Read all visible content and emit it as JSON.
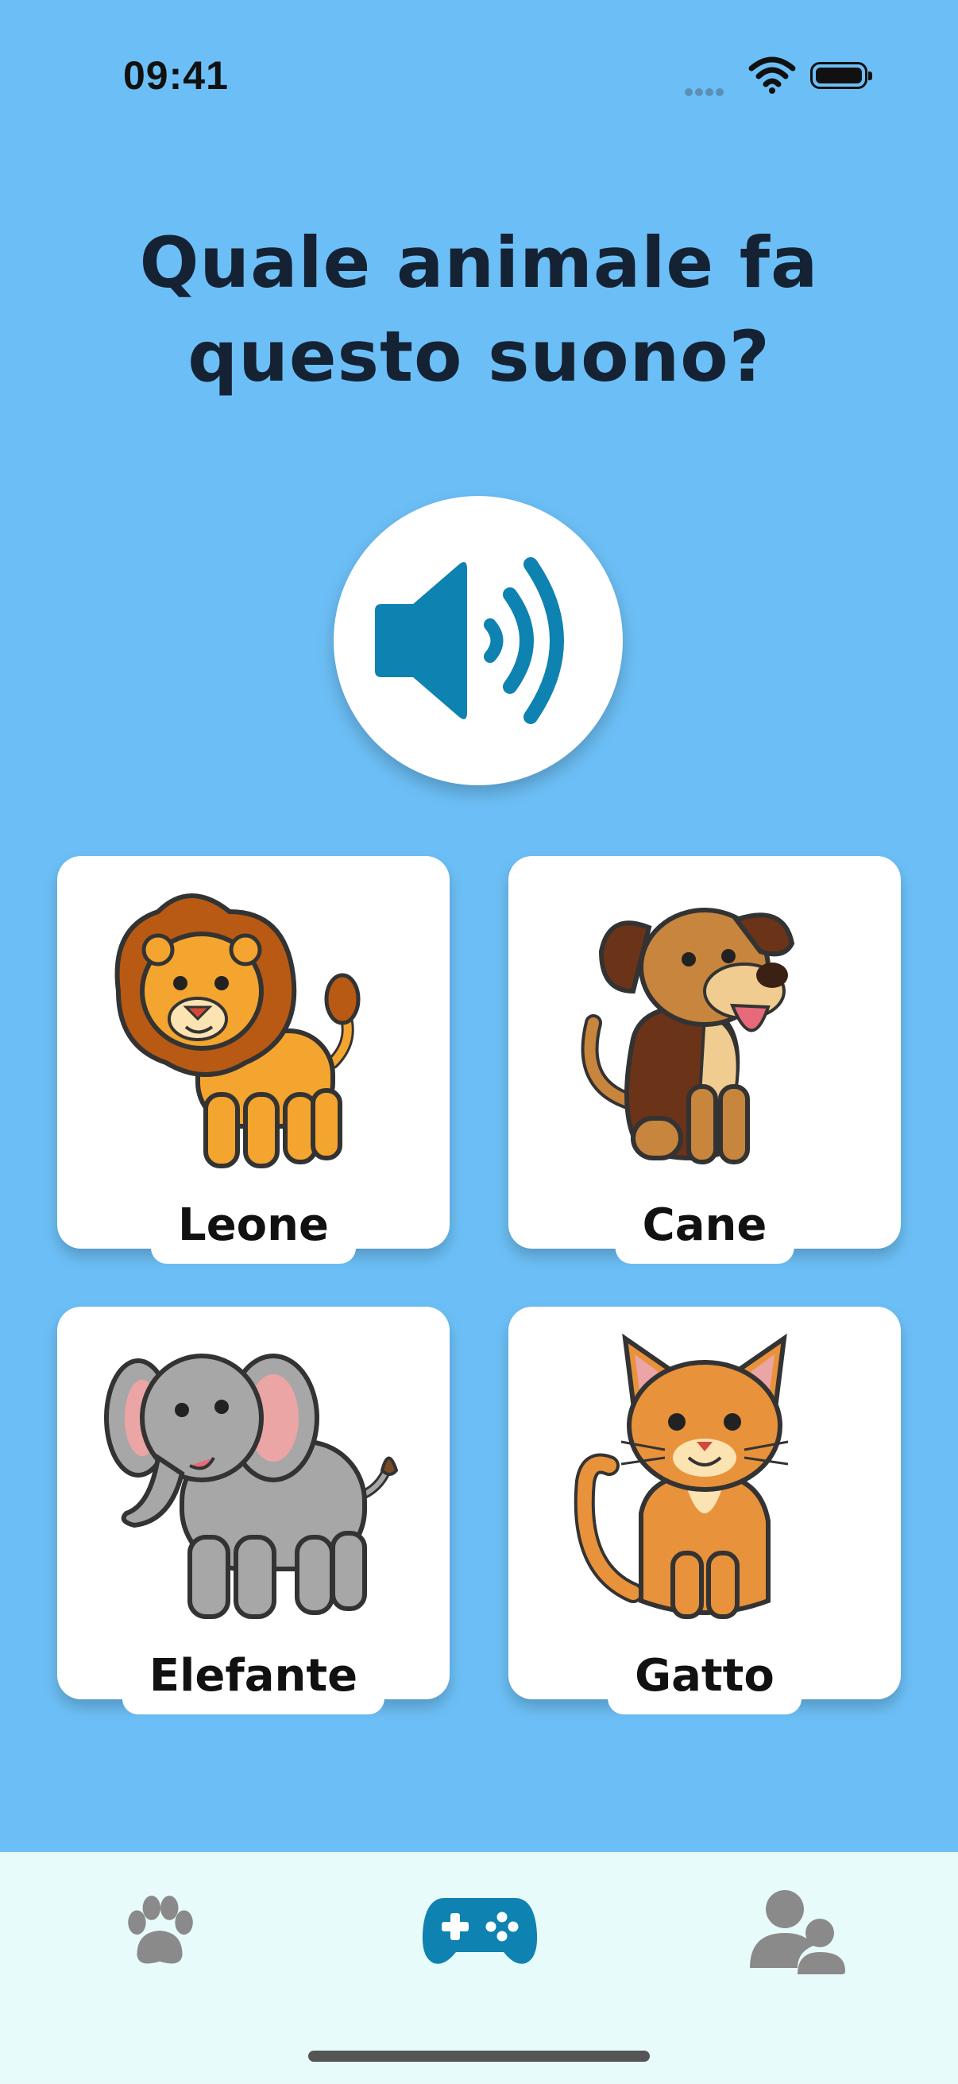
{
  "status_bar": {
    "time": "09:41"
  },
  "question": {
    "line1": "Quale animale fa",
    "line2": "questo suono?"
  },
  "play_button": {
    "icon": "speaker-icon",
    "color": "#0e82b0"
  },
  "answers": [
    {
      "label": "Leone",
      "icon": "lion-illustration"
    },
    {
      "label": "Cane",
      "icon": "dog-illustration"
    },
    {
      "label": "Elefante",
      "icon": "elephant-illustration"
    },
    {
      "label": "Gatto",
      "icon": "cat-illustration"
    }
  ],
  "tabbar": {
    "tabs": [
      {
        "icon": "paw-icon",
        "active": false
      },
      {
        "icon": "gamepad-icon",
        "active": true
      },
      {
        "icon": "users-icon",
        "active": false
      }
    ],
    "active_color": "#0e82b0",
    "inactive_color": "#8a8a8a"
  }
}
